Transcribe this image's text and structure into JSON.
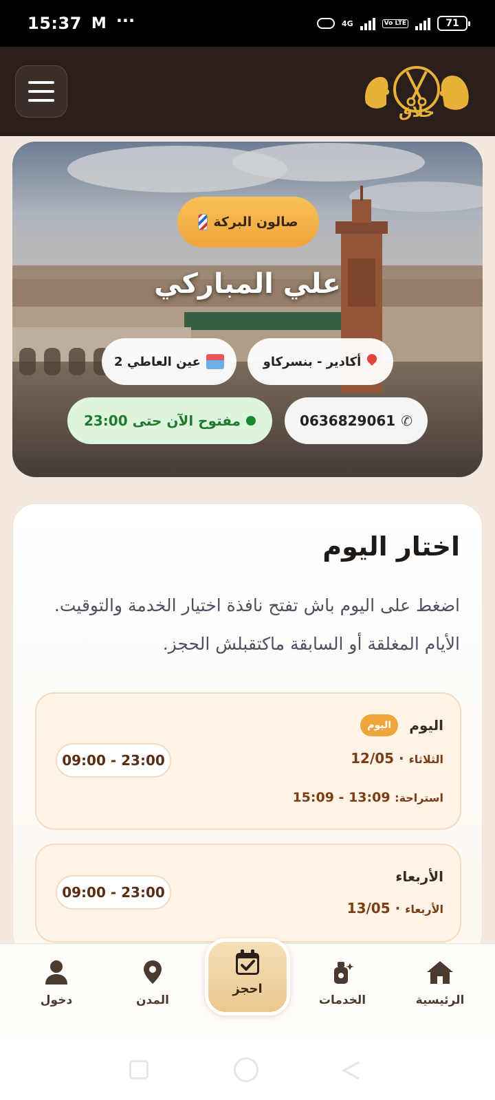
{
  "status_bar": {
    "time": "15:37",
    "mail_icon": "M",
    "dots": "···",
    "network": "4G",
    "volte": "Vo LTE",
    "battery": "71"
  },
  "header": {
    "menu_icon": "hamburger-menu-icon",
    "logo_text": "حلاق",
    "logo_color": "#e8b23a"
  },
  "hero": {
    "salon_badge": "صالون البركة",
    "barber_name": "علي المباركي",
    "location": "أكادير - بنسركاو",
    "district": "عين العاطي 2",
    "phone": "0636829061",
    "open_status": "مفتوح الآن حتى 23:00"
  },
  "day_picker": {
    "title": "اختار اليوم",
    "description": "اضغط على اليوم باش تفتح نافذة اختيار الخدمة والتوقيت. الأيام المغلقة أو السابقة ماكتقبلش الحجز.",
    "days": [
      {
        "name": "اليوم",
        "badge": "اليوم",
        "weekday": "الثلاثاء",
        "date": "12/05",
        "hours": "09:00 - 23:00",
        "break_label": "استراحة:",
        "break_time": "13:09 - 15:09"
      },
      {
        "name": "الأربعاء",
        "weekday": "الأربعاء",
        "date": "13/05",
        "hours": "09:00 - 23:00"
      }
    ]
  },
  "bottom_nav": {
    "home": "الرئيسية",
    "services": "الخدمات",
    "book": "احجز",
    "cities": "المدن",
    "login": "دخول"
  },
  "colors": {
    "accent": "#f0a43c",
    "header_bg": "#2a1f1a",
    "open_green": "#1b8a35",
    "date_brown": "#7a3e14"
  }
}
